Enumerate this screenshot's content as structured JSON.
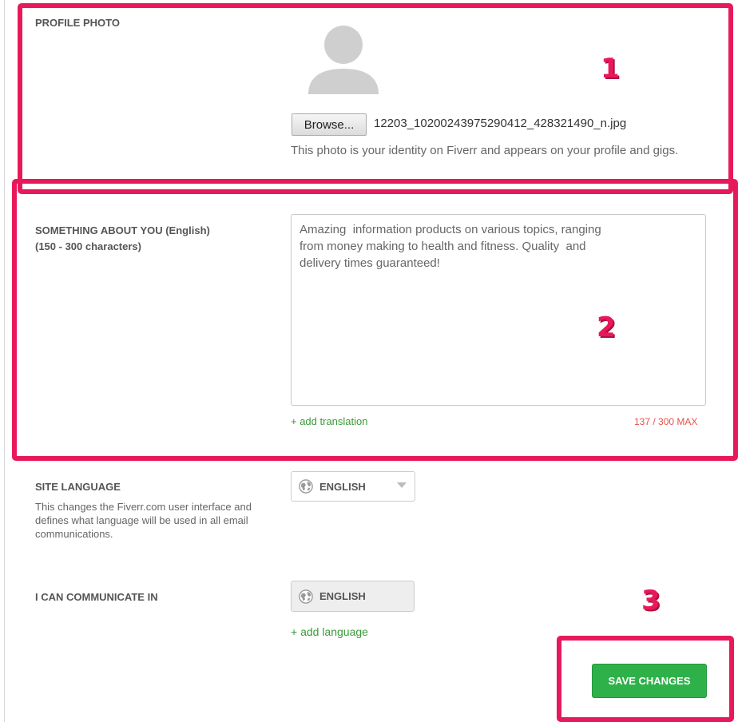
{
  "profile_photo": {
    "label": "PROFILE PHOTO",
    "browse_label": "Browse...",
    "file_name": "12203_10200243975290412_428321490_n.jpg",
    "description": "This photo is your identity on Fiverr and appears on your profile and gigs."
  },
  "about": {
    "label_line1": "SOMETHING ABOUT YOU (English)",
    "label_line2": "(150 - 300 characters)",
    "value": "Amazing  information products on various topics, ranging\nfrom money making to health and fitness. Quality  and\ndelivery times guaranteed!",
    "add_translation": "+ add translation",
    "counter": "137 / 300 MAX"
  },
  "site_language": {
    "label": "SITE LANGUAGE",
    "description": "This changes the Fiverr.com user interface and defines what language will be used in all email communications.",
    "selected": "ENGLISH"
  },
  "communicate": {
    "label": "I CAN COMMUNICATE IN",
    "language": "ENGLISH",
    "add_language": "+ add language"
  },
  "save_label": "SAVE CHANGES",
  "annotations": {
    "m1": "1",
    "m2": "2",
    "m3": "3"
  },
  "colors": {
    "highlight": "#e8195b",
    "save": "#2fb14a",
    "link": "#3a9a3a",
    "counter": "#e8504a"
  },
  "icons": [
    "avatar-placeholder",
    "globe-icon",
    "chevron-down-icon"
  ]
}
